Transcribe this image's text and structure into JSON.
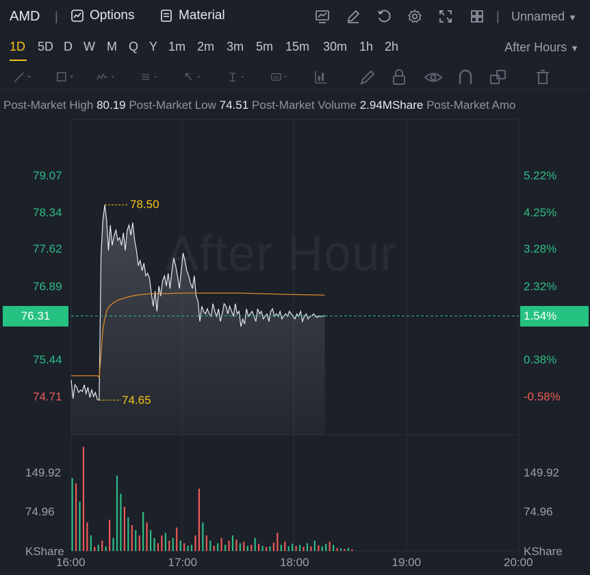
{
  "header": {
    "symbol": "AMD",
    "options_label": "Options",
    "material_label": "Material",
    "layout_name": "Unnamed",
    "icons": [
      "chart-icon",
      "edit-icon",
      "refresh-icon",
      "settings-icon",
      "fullscreen-icon",
      "grid-icon"
    ]
  },
  "timeframes": [
    "1D",
    "5D",
    "D",
    "W",
    "M",
    "Q",
    "Y",
    "1m",
    "2m",
    "3m",
    "5m",
    "15m",
    "30m",
    "1h",
    "2h"
  ],
  "active_timeframe": "1D",
  "session": "After Hours",
  "drawing_tools": [
    "line-tool-icon",
    "rectangle-tool-icon",
    "pattern-tool-icon",
    "fib-tool-icon",
    "arrow-tool-icon",
    "measure-tool-icon",
    "text-tool-icon",
    "indicator-tool-icon",
    "brush-icon",
    "lock-icon",
    "eye-icon",
    "magnet-icon",
    "layers-icon",
    "trash-icon"
  ],
  "info": [
    {
      "label": "Post-Market High",
      "value": "80.19"
    },
    {
      "label": "Post-Market Low",
      "value": "74.51"
    },
    {
      "label": "Post-Market Volume",
      "value": "2.94MShare"
    },
    {
      "label": "Post-Market Amo",
      "value": ""
    }
  ],
  "watermark": "After Hour",
  "colors": {
    "up": "#2ebd85",
    "down": "#ec5b56",
    "mark": "#f5c518",
    "avg": "#e08a2b",
    "line": "#e6e9ef"
  },
  "chart_data": {
    "type": "line",
    "x_start": "16:00",
    "x_ticks": [
      "16:00",
      "17:00",
      "18:00",
      "19:00",
      "20:00"
    ],
    "y_left_ticks": [
      {
        "label": "79.07",
        "value": 79.07,
        "color": "up"
      },
      {
        "label": "78.34",
        "value": 78.34,
        "color": "up"
      },
      {
        "label": "77.62",
        "value": 77.62,
        "color": "up"
      },
      {
        "label": "76.89",
        "value": 76.89,
        "color": "up"
      },
      {
        "label": "75.44",
        "value": 75.44,
        "color": "up"
      },
      {
        "label": "74.71",
        "value": 74.71,
        "color": "down"
      }
    ],
    "y_right_ticks": [
      {
        "label": "5.22%",
        "value": 79.07,
        "color": "up"
      },
      {
        "label": "4.25%",
        "value": 78.34,
        "color": "up"
      },
      {
        "label": "3.28%",
        "value": 77.62,
        "color": "up"
      },
      {
        "label": "2.32%",
        "value": 76.89,
        "color": "up"
      },
      {
        "label": "0.38%",
        "value": 75.44,
        "color": "up"
      },
      {
        "label": "-0.58%",
        "value": 74.71,
        "color": "down"
      }
    ],
    "ylim": [
      74.0,
      79.9
    ],
    "current_price": "76.31",
    "current_price_value": 76.31,
    "current_pct": "1.54%",
    "high_mark": {
      "label": "78.50",
      "value": 78.5,
      "minute": 18
    },
    "low_mark": {
      "label": "74.65",
      "value": 74.65,
      "minute": 15
    },
    "series": [
      {
        "name": "Price",
        "x_minutes": [
          0,
          1,
          2,
          3,
          4,
          5,
          6,
          7,
          8,
          9,
          10,
          11,
          12,
          13,
          14,
          15,
          16,
          17,
          18,
          19,
          20,
          21,
          22,
          23,
          24,
          25,
          26,
          27,
          28,
          29,
          30,
          31,
          32,
          33,
          34,
          35,
          36,
          37,
          38,
          39,
          40,
          41,
          42,
          43,
          44,
          45,
          46,
          47,
          48,
          49,
          50,
          51,
          52,
          53,
          54,
          55,
          56,
          57,
          58,
          59,
          60,
          61,
          62,
          63,
          64,
          65,
          66,
          67,
          68,
          69,
          70,
          71,
          72,
          73,
          74,
          75,
          76,
          77,
          78,
          79,
          80,
          81,
          82,
          83,
          84,
          85,
          86,
          87,
          88,
          89,
          90,
          91,
          92,
          93,
          94,
          95,
          96,
          97,
          98,
          99,
          100,
          101,
          102,
          103,
          104,
          105,
          106,
          107,
          108,
          109,
          110,
          111,
          112,
          113,
          114,
          115,
          116,
          117,
          118,
          119,
          120,
          121,
          122,
          123,
          124,
          125,
          126,
          127,
          128,
          129,
          130,
          131,
          132,
          133,
          134,
          135,
          136
        ],
        "values": [
          75.05,
          74.68,
          74.95,
          74.9,
          74.8,
          74.85,
          74.82,
          74.95,
          74.78,
          74.9,
          74.7,
          74.85,
          74.72,
          74.8,
          74.66,
          74.65,
          77.5,
          78.2,
          78.5,
          78.2,
          77.6,
          78.1,
          77.7,
          77.9,
          78.0,
          77.8,
          77.85,
          77.7,
          77.95,
          77.6,
          78.0,
          78.1,
          77.9,
          78.15,
          77.8,
          77.6,
          77.3,
          77.4,
          77.2,
          77.35,
          77.1,
          77.15,
          77.05,
          76.75,
          76.5,
          76.8,
          76.4,
          76.9,
          76.7,
          77.0,
          77.1,
          76.9,
          77.15,
          76.85,
          77.2,
          77.45,
          77.3,
          77.1,
          76.85,
          77.2,
          77.55,
          77.4,
          77.2,
          77.1,
          76.95,
          76.85,
          77.1,
          76.7,
          76.6,
          76.2,
          76.5,
          76.4,
          76.35,
          76.45,
          76.35,
          76.3,
          76.55,
          76.4,
          76.3,
          76.45,
          76.2,
          76.35,
          76.55,
          76.5,
          76.35,
          76.5,
          76.4,
          76.3,
          76.55,
          76.35,
          76.4,
          76.1,
          76.25,
          76.15,
          76.45,
          76.3,
          76.35,
          76.4,
          76.3,
          76.2,
          76.45,
          76.35,
          76.4,
          76.25,
          76.3,
          76.35,
          76.2,
          76.4,
          76.45,
          76.3,
          76.35,
          76.3,
          76.4,
          76.25,
          76.3,
          76.35,
          76.3,
          76.4,
          76.35,
          76.3,
          76.25,
          76.35,
          76.3,
          76.4,
          76.2,
          76.3,
          76.35,
          76.25,
          76.3,
          76.31,
          76.35,
          76.3,
          76.28,
          76.31,
          76.3,
          76.31,
          76.31
        ]
      },
      {
        "name": "Average",
        "x_minutes": [
          0,
          14,
          15,
          16,
          17,
          18,
          19,
          20,
          22,
          25,
          30,
          35,
          40,
          45,
          50,
          60,
          70,
          80,
          90,
          100,
          110,
          120,
          136
        ],
        "values": [
          75.13,
          75.13,
          75.1,
          75.55,
          76.05,
          76.25,
          76.4,
          76.48,
          76.55,
          76.62,
          76.68,
          76.72,
          76.74,
          76.75,
          76.75,
          76.76,
          76.76,
          76.76,
          76.76,
          76.75,
          76.74,
          76.73,
          76.72
        ]
      }
    ],
    "volume": {
      "ylabel": "KShare",
      "ticks": [
        {
          "label": "149.92",
          "value": 149.92
        },
        {
          "label": "74.96",
          "value": 74.96
        }
      ],
      "ylim": [
        0,
        210
      ],
      "bars": [
        {
          "v": 140,
          "d": "up"
        },
        {
          "v": 130,
          "d": "down"
        },
        {
          "v": 95,
          "d": "up"
        },
        {
          "v": 200,
          "d": "down"
        },
        {
          "v": 55,
          "d": "down"
        },
        {
          "v": 30,
          "d": "up"
        },
        {
          "v": 8,
          "d": "down"
        },
        {
          "v": 12,
          "d": "up"
        },
        {
          "v": 20,
          "d": "down"
        },
        {
          "v": 9,
          "d": "up"
        },
        {
          "v": 60,
          "d": "down"
        },
        {
          "v": 25,
          "d": "up"
        },
        {
          "v": 145,
          "d": "up"
        },
        {
          "v": 110,
          "d": "up"
        },
        {
          "v": 85,
          "d": "down"
        },
        {
          "v": 65,
          "d": "up"
        },
        {
          "v": 50,
          "d": "down"
        },
        {
          "v": 40,
          "d": "up"
        },
        {
          "v": 30,
          "d": "down"
        },
        {
          "v": 75,
          "d": "up"
        },
        {
          "v": 55,
          "d": "down"
        },
        {
          "v": 40,
          "d": "up"
        },
        {
          "v": 25,
          "d": "up"
        },
        {
          "v": 15,
          "d": "down"
        },
        {
          "v": 30,
          "d": "down"
        },
        {
          "v": 35,
          "d": "up"
        },
        {
          "v": 20,
          "d": "down"
        },
        {
          "v": 25,
          "d": "up"
        },
        {
          "v": 45,
          "d": "down"
        },
        {
          "v": 20,
          "d": "up"
        },
        {
          "v": 15,
          "d": "down"
        },
        {
          "v": 10,
          "d": "up"
        },
        {
          "v": 12,
          "d": "up"
        },
        {
          "v": 30,
          "d": "down"
        },
        {
          "v": 120,
          "d": "down"
        },
        {
          "v": 55,
          "d": "up"
        },
        {
          "v": 30,
          "d": "down"
        },
        {
          "v": 20,
          "d": "up"
        },
        {
          "v": 10,
          "d": "down"
        },
        {
          "v": 15,
          "d": "up"
        },
        {
          "v": 25,
          "d": "down"
        },
        {
          "v": 12,
          "d": "up"
        },
        {
          "v": 20,
          "d": "down"
        },
        {
          "v": 30,
          "d": "up"
        },
        {
          "v": 22,
          "d": "down"
        },
        {
          "v": 15,
          "d": "up"
        },
        {
          "v": 18,
          "d": "down"
        },
        {
          "v": 10,
          "d": "up"
        },
        {
          "v": 12,
          "d": "down"
        },
        {
          "v": 25,
          "d": "up"
        },
        {
          "v": 14,
          "d": "down"
        },
        {
          "v": 10,
          "d": "up"
        },
        {
          "v": 8,
          "d": "down"
        },
        {
          "v": 9,
          "d": "up"
        },
        {
          "v": 16,
          "d": "down"
        },
        {
          "v": 35,
          "d": "down"
        },
        {
          "v": 12,
          "d": "up"
        },
        {
          "v": 18,
          "d": "down"
        },
        {
          "v": 9,
          "d": "up"
        },
        {
          "v": 14,
          "d": "up"
        },
        {
          "v": 10,
          "d": "down"
        },
        {
          "v": 12,
          "d": "up"
        },
        {
          "v": 8,
          "d": "down"
        },
        {
          "v": 15,
          "d": "up"
        },
        {
          "v": 9,
          "d": "down"
        },
        {
          "v": 20,
          "d": "up"
        },
        {
          "v": 11,
          "d": "down"
        },
        {
          "v": 9,
          "d": "up"
        },
        {
          "v": 14,
          "d": "up"
        },
        {
          "v": 18,
          "d": "down"
        },
        {
          "v": 12,
          "d": "up"
        },
        {
          "v": 6,
          "d": "down"
        },
        {
          "v": 5,
          "d": "up"
        },
        {
          "v": 4,
          "d": "down"
        },
        {
          "v": 6,
          "d": "up"
        },
        {
          "v": 3,
          "d": "down"
        }
      ]
    }
  }
}
